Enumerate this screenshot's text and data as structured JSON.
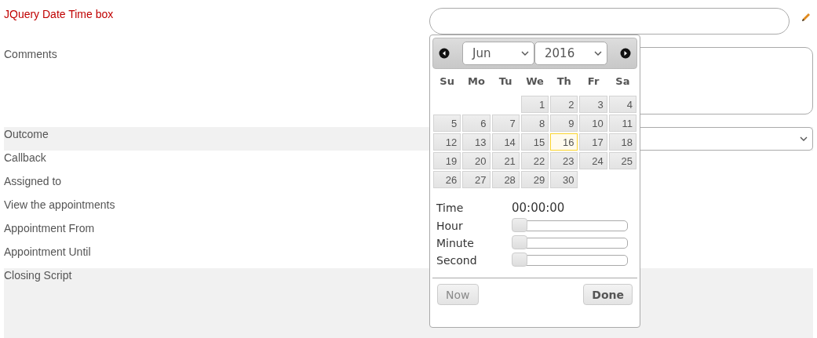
{
  "fields": [
    {
      "label": "JQuery Date Time box",
      "kind": "datetime",
      "highlighted": true,
      "shaded": false
    },
    {
      "label": "Comments",
      "kind": "textarea",
      "highlighted": false,
      "shaded": false
    },
    {
      "label": "Outcome",
      "kind": "select",
      "highlighted": false,
      "shaded": true
    },
    {
      "label": "Callback",
      "kind": "plain",
      "highlighted": false,
      "shaded": false
    },
    {
      "label": "Assigned to",
      "kind": "plain",
      "highlighted": false,
      "shaded": false
    },
    {
      "label": "View the appointments",
      "kind": "plain",
      "highlighted": false,
      "shaded": false
    },
    {
      "label": "Appointment From",
      "kind": "plain",
      "highlighted": false,
      "shaded": false
    },
    {
      "label": "Appointment Until",
      "kind": "plain",
      "highlighted": false,
      "shaded": false
    },
    {
      "label": "Closing Script",
      "kind": "tall",
      "highlighted": false,
      "shaded": true
    }
  ],
  "datepicker": {
    "month": "Jun",
    "year": "2016",
    "weekdays": [
      "Su",
      "Mo",
      "Tu",
      "We",
      "Th",
      "Fr",
      "Sa"
    ],
    "weeks": [
      [
        {
          "kind": "blank"
        },
        {
          "kind": "blank"
        },
        {
          "kind": "blank"
        },
        {
          "day": "1",
          "today": false
        },
        {
          "day": "2",
          "today": false
        },
        {
          "day": "3",
          "today": false
        },
        {
          "day": "4",
          "today": false
        }
      ],
      [
        {
          "day": "5",
          "today": false
        },
        {
          "day": "6",
          "today": false
        },
        {
          "day": "7",
          "today": false
        },
        {
          "day": "8",
          "today": false
        },
        {
          "day": "9",
          "today": false
        },
        {
          "day": "10",
          "today": false
        },
        {
          "day": "11",
          "today": false
        }
      ],
      [
        {
          "day": "12",
          "today": false
        },
        {
          "day": "13",
          "today": false
        },
        {
          "day": "14",
          "today": false
        },
        {
          "day": "15",
          "today": false
        },
        {
          "day": "16",
          "today": true
        },
        {
          "day": "17",
          "today": false
        },
        {
          "day": "18",
          "today": false
        }
      ],
      [
        {
          "day": "19",
          "today": false
        },
        {
          "day": "20",
          "today": false
        },
        {
          "day": "21",
          "today": false
        },
        {
          "day": "22",
          "today": false
        },
        {
          "day": "23",
          "today": false
        },
        {
          "day": "24",
          "today": false
        },
        {
          "day": "25",
          "today": false
        }
      ],
      [
        {
          "day": "26",
          "today": false
        },
        {
          "day": "27",
          "today": false
        },
        {
          "day": "28",
          "today": false
        },
        {
          "day": "29",
          "today": false
        },
        {
          "day": "30",
          "today": false
        },
        {
          "kind": "blank"
        },
        {
          "kind": "blank"
        }
      ]
    ],
    "time_label": "Time",
    "time_value": "00:00:00",
    "sliders": [
      {
        "label": "Hour",
        "level": 0
      },
      {
        "label": "Minute",
        "level": 0
      },
      {
        "label": "Second",
        "level": 0
      }
    ],
    "buttons": [
      {
        "label": "Now",
        "disabled": true
      },
      {
        "label": "Done",
        "disabled": false
      }
    ]
  }
}
